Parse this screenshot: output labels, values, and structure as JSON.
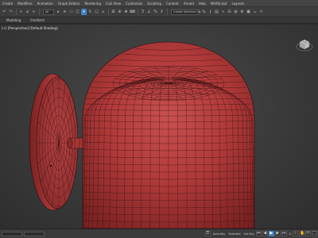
{
  "menu": [
    "Create",
    "Modifiers",
    "Animation",
    "Graph Editors",
    "Rendering",
    "Civil View",
    "Customize",
    "Scripting",
    "Content",
    "Arnold",
    "Help",
    "MAXScript",
    "Layouts"
  ],
  "toolbar": {
    "selection_filter": "All",
    "named_selection": "Create Selection Se",
    "active_tool_index": 4
  },
  "ribbon": {
    "tabs": [
      "Modeling",
      "Freeform"
    ]
  },
  "viewport": {
    "label": "[+] [Perspective] [Default Shading]"
  },
  "viewcube": {
    "face_label": "TOP"
  },
  "statusbar": {
    "key_mode": "Auto Key",
    "set_key": "Set Key",
    "selected": "Selected",
    "frame": "0"
  },
  "colors": {
    "mesh": "#b03a3a",
    "wire": "#2a0c0c",
    "accent": "#3f7fbf",
    "background": "#3a3a3a"
  }
}
